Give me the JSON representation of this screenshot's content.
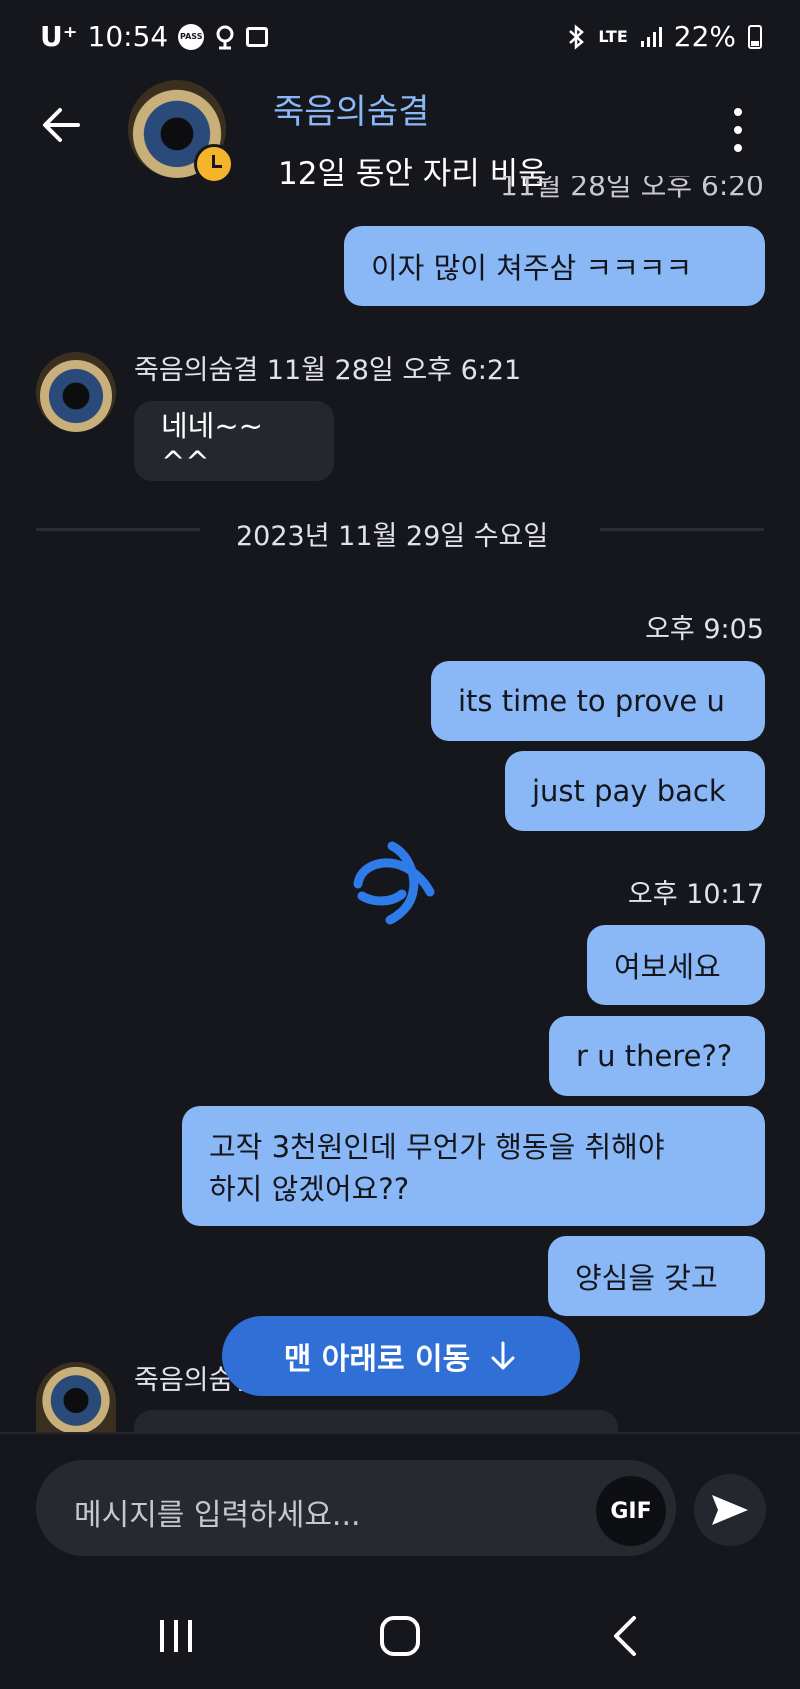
{
  "status_bar": {
    "carrier": "U⁺",
    "time": "10:54",
    "pass_icon_label": "PASS",
    "network": "LTE",
    "battery": "22%"
  },
  "header": {
    "contact_name": "죽음의숨결",
    "away_status": "12일 동안 자리 비움"
  },
  "clipped_timestamp": "11월 28일 오후 6:20",
  "messages": {
    "m1": "이자 많이 쳐주삼 ㅋㅋㅋㅋ",
    "m2_meta": "죽음의숨결 11월 28일 오후 6:21",
    "m2": "네네~~ ^^",
    "date_divider": "2023년 11월 29일 수요일",
    "t1": "오후 9:05",
    "m3": "its time to prove u",
    "m4": "just pay back",
    "t2": "오후 10:17",
    "m5": "여보세요",
    "m6": "r u there??",
    "m7_line1": "고작 3천원인데 무언가 행동을 취해야",
    "m7_line2": "하지 않겠어요??",
    "m8": "양심을 갖고",
    "m9_meta_partial": "죽음의숨결"
  },
  "jump_button": {
    "label": "맨 아래로 이동",
    "icon": "arrow-down-icon"
  },
  "composer": {
    "placeholder": "메시지를 입력하세요...",
    "gif_label": "GIF",
    "send_icon": "send-icon"
  },
  "nav_bar": {
    "recents_icon": "recents-icon",
    "home_icon": "home-icon",
    "back_icon": "back-icon"
  },
  "colors": {
    "background": "#16171d",
    "outgoing_bubble": "#8ab8f7",
    "incoming_bubble": "#25272e",
    "accent_button": "#2f6fd6",
    "away_badge": "#f5b52b"
  }
}
